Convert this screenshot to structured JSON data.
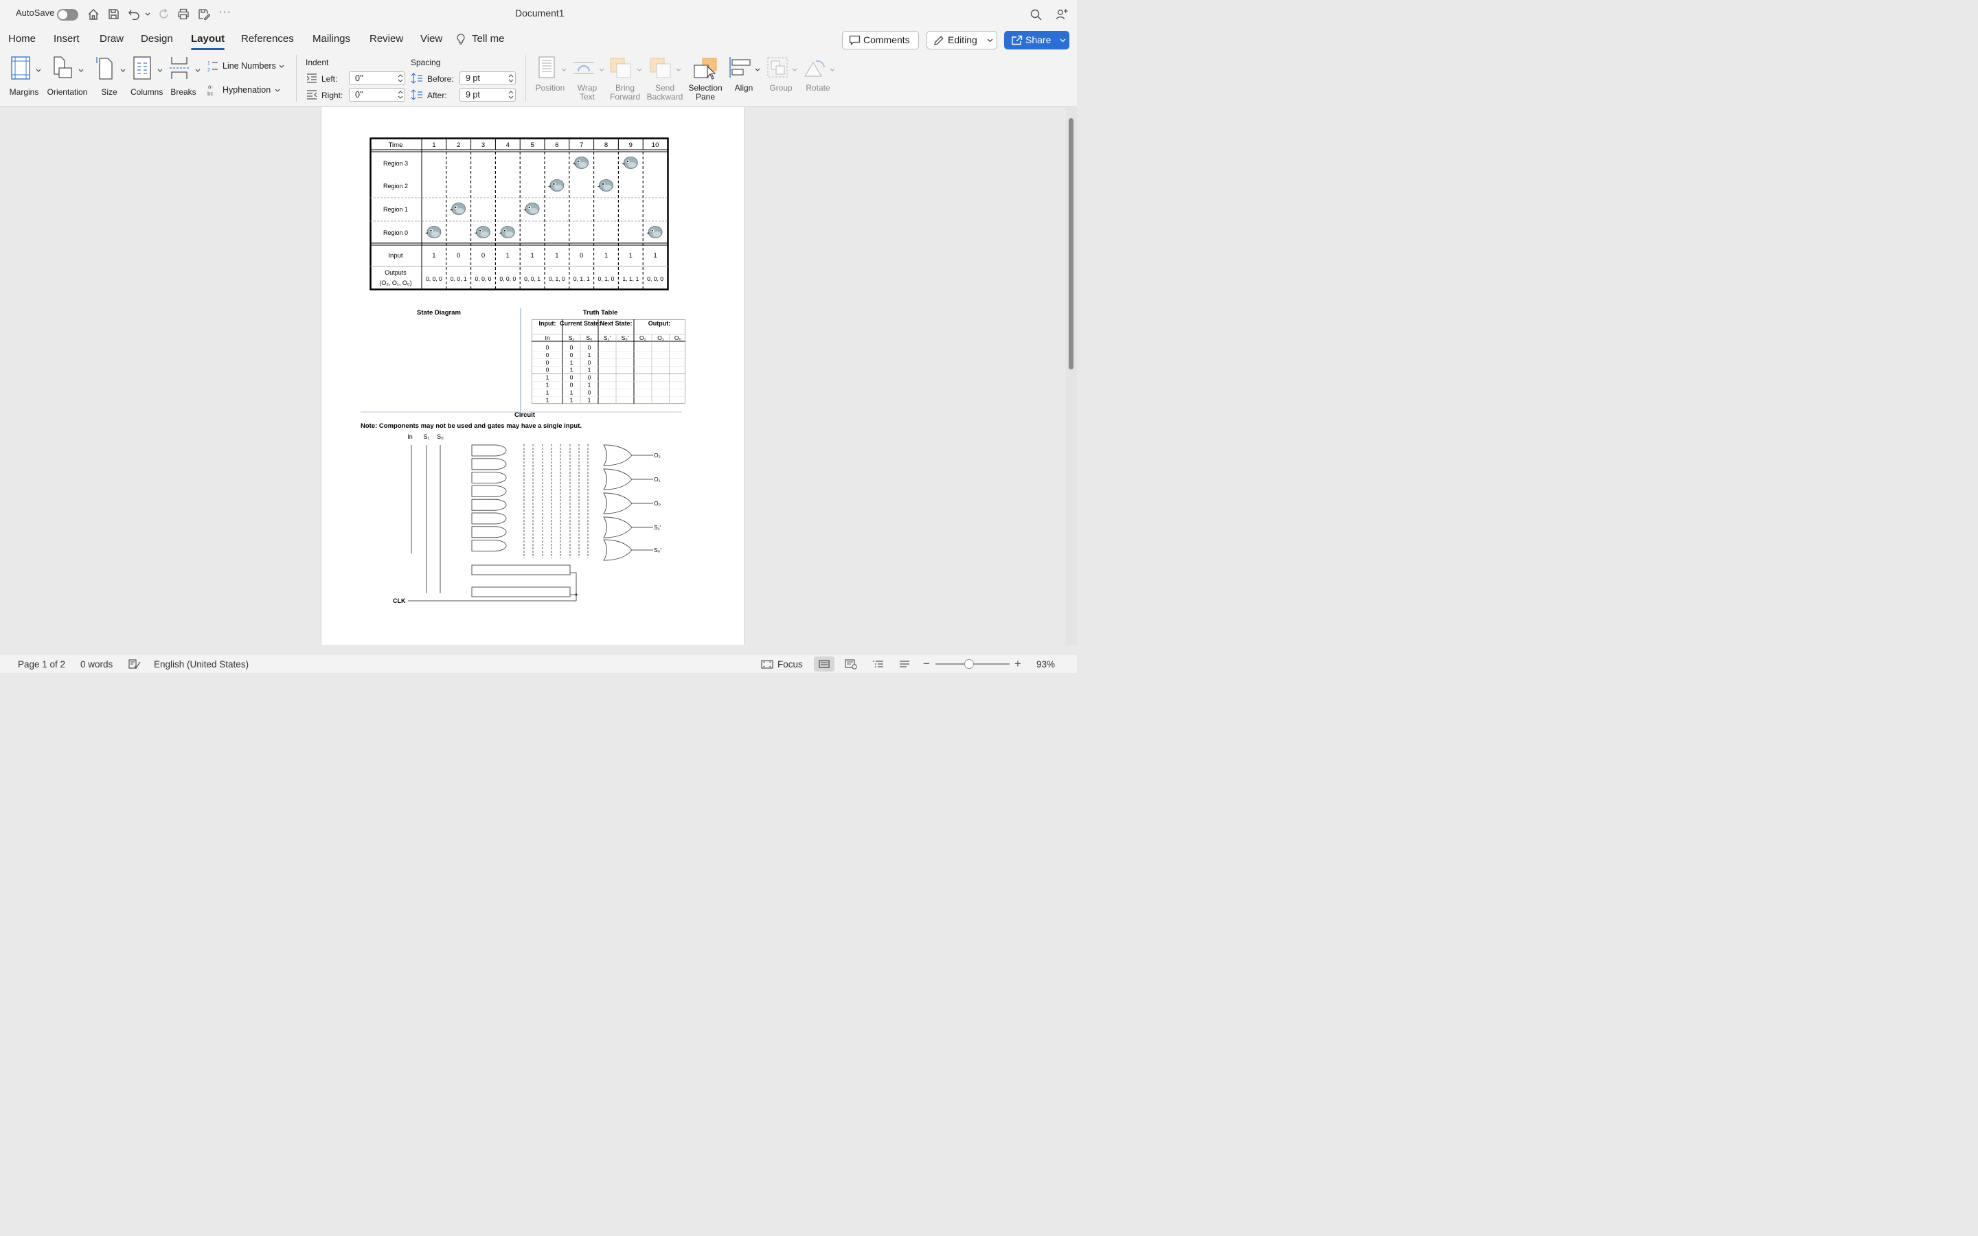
{
  "titlebar": {
    "autosave_label": "AutoSave",
    "document_title": "Document1"
  },
  "tabs": [
    {
      "label": "Home"
    },
    {
      "label": "Insert"
    },
    {
      "label": "Draw"
    },
    {
      "label": "Design"
    },
    {
      "label": "Layout",
      "active": true
    },
    {
      "label": "References"
    },
    {
      "label": "Mailings"
    },
    {
      "label": "Review"
    },
    {
      "label": "View"
    },
    {
      "label": "Tell me"
    }
  ],
  "toolbar": {
    "comments_label": "Comments",
    "editing_label": "Editing",
    "share_label": "Share"
  },
  "ribbon": {
    "margins": "Margins",
    "orientation": "Orientation",
    "size": "Size",
    "columns": "Columns",
    "breaks": "Breaks",
    "line_numbers": "Line Numbers",
    "hyphenation": "Hyphenation",
    "indent_header": "Indent",
    "indent_left_label": "Left:",
    "indent_left_value": "0\"",
    "indent_right_label": "Right:",
    "indent_right_value": "0\"",
    "spacing_header": "Spacing",
    "spacing_before_label": "Before:",
    "spacing_before_value": "9 pt",
    "spacing_after_label": "After:",
    "spacing_after_value": "9 pt",
    "position": "Position",
    "wrap_text_1": "Wrap",
    "wrap_text_2": "Text",
    "bring_forward_1": "Bring",
    "bring_forward_2": "Forward",
    "send_backward_1": "Send",
    "send_backward_2": "Backward",
    "selection_pane_1": "Selection",
    "selection_pane_2": "Pane",
    "align": "Align",
    "group": "Group",
    "rotate": "Rotate"
  },
  "document": {
    "timing_table": {
      "time_header": "Time",
      "times": [
        "1",
        "2",
        "3",
        "4",
        "5",
        "6",
        "7",
        "8",
        "9",
        "10"
      ],
      "regions": [
        "Region 3",
        "Region 2",
        "Region 1",
        "Region 0"
      ],
      "bird_region_index_by_time": [
        3,
        2,
        3,
        3,
        2,
        1,
        0,
        1,
        0,
        3
      ],
      "input_label": "Input",
      "inputs": [
        "1",
        "0",
        "0",
        "1",
        "1",
        "1",
        "0",
        "1",
        "1",
        "1"
      ],
      "outputs_label": "Outputs",
      "outputs_sublabel": "(O₂, O₁, O₀)",
      "outputs": [
        "0, 0, 0",
        "0, 0, 1",
        "0, 0, 0",
        "0, 0, 0",
        "0, 0, 1",
        "0, 1, 0",
        "0, 1, 1",
        "0, 1, 0",
        "1, 1, 1",
        "0, 0, 0"
      ]
    },
    "state_diagram_title": "State Diagram",
    "truth_table": {
      "title": "Truth Table",
      "group_headers": [
        "Input:",
        "Current State:",
        "Next State:",
        "Output:"
      ],
      "col_headers": [
        "In",
        "S₁",
        "S₀",
        "S₁'",
        "S₀'",
        "O₂",
        "O₁",
        "O₀"
      ],
      "rows": [
        [
          "0",
          "0",
          "0"
        ],
        [
          "0",
          "0",
          "1"
        ],
        [
          "0",
          "1",
          "0"
        ],
        [
          "0",
          "1",
          "1"
        ],
        [
          "1",
          "0",
          "0"
        ],
        [
          "1",
          "0",
          "1"
        ],
        [
          "1",
          "1",
          "0"
        ],
        [
          "1",
          "1",
          "1"
        ]
      ]
    },
    "circuit": {
      "title": "Circuit",
      "note": "Note: Components may not be used and gates may have a single input.",
      "inputs": [
        "In",
        "S₁",
        "S₀"
      ],
      "outputs": [
        "O₂",
        "O₁",
        "O₀",
        "S₁'",
        "S₀'"
      ],
      "clock_label": "CLK"
    }
  },
  "status": {
    "page": "Page 1 of 2",
    "words": "0 words",
    "language": "English (United States)",
    "focus": "Focus",
    "zoom": "93%"
  }
}
